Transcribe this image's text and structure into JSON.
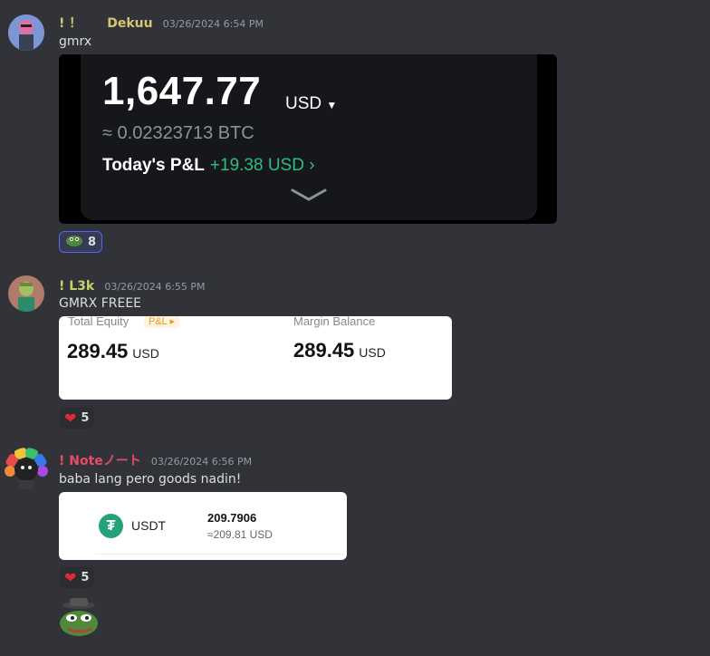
{
  "messages": [
    {
      "author": "! ！　　Dekuu",
      "author_color": "#d4c770",
      "timestamp": "03/26/2024 6:54 PM",
      "text": "gmrx",
      "attachment": {
        "balance": "1,647.77",
        "currency": "USD",
        "btc_equiv": "≈ 0.02323713 BTC",
        "pnl_label": "Today's P&L",
        "pnl_value": "+19.38 USD"
      },
      "reaction": {
        "emoji": "pepe-emoji",
        "count": "8",
        "active": true
      }
    },
    {
      "author": "! L3k",
      "author_color": "#c9d16a",
      "timestamp": "03/26/2024 6:55 PM",
      "text": "GMRX FREEE",
      "attachment": {
        "total_equity_label": "Total Equity",
        "pnl_badge": "P&L ▸",
        "total_equity_value": "289.45",
        "margin_balance_label": "Margin Balance",
        "margin_balance_value": "289.45",
        "unit": "USD"
      },
      "reaction": {
        "emoji": "heart-emoji",
        "count": "5",
        "active": false
      }
    },
    {
      "author": "! Noteノート",
      "author_color": "#e64c6a",
      "timestamp": "03/26/2024 6:56 PM",
      "text": "baba lang pero goods nadin!",
      "attachment": {
        "symbol": "USDT",
        "amount": "209.7906",
        "usd_equiv": "≈209.81 USD"
      },
      "reaction": {
        "emoji": "heart-emoji",
        "count": "5",
        "active": false
      }
    }
  ]
}
